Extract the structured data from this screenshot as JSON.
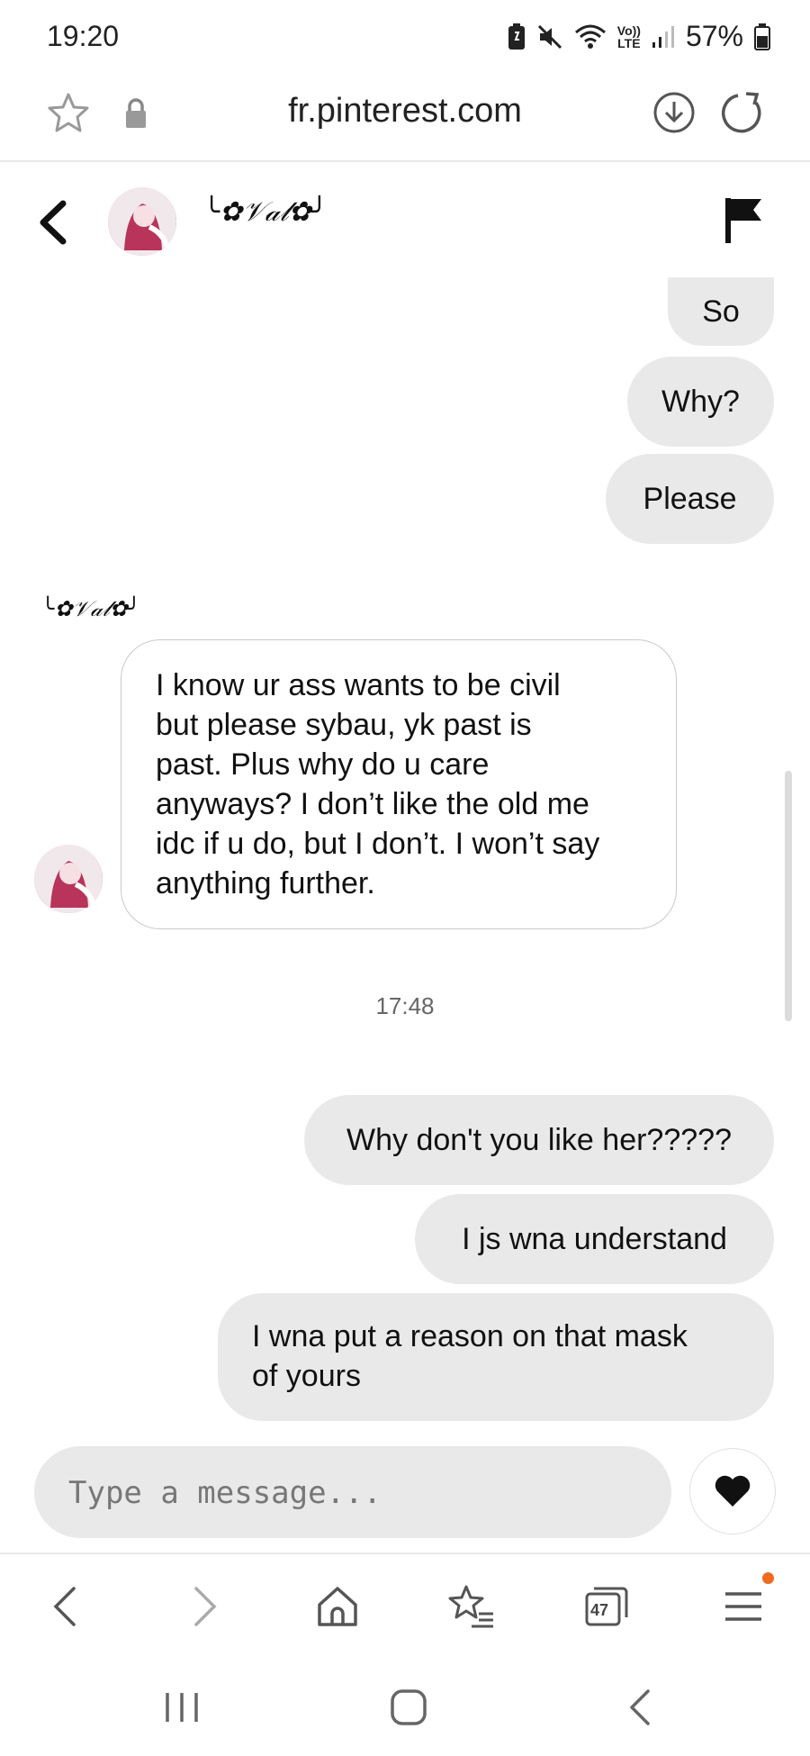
{
  "status_bar": {
    "time": "19:20",
    "battery": "57%",
    "network_top": "Vo))",
    "network_bottom": "LTE"
  },
  "browser": {
    "url": "fr.pinterest.com",
    "tab_count": "47"
  },
  "chat": {
    "contact_name": "╰✿𝒱𝒶𝓁✿╯",
    "messages_top": [
      {
        "text": "So"
      },
      {
        "text": "Why?"
      },
      {
        "text": "Please"
      }
    ],
    "incoming_sender": "╰✿𝒱𝒶𝓁✿╯",
    "incoming_lines": [
      "I know ur ass wants to be civil",
      "but please sybau, yk past is",
      "past. Plus why do u care",
      "anyways? I don’t like the old me",
      "idc if u do, but I don’t. I won’t say",
      "anything further."
    ],
    "timestamp": "17:48",
    "messages_bottom": [
      {
        "text": "Why don't you like her?????"
      },
      {
        "text": "I js wna understand"
      },
      {
        "line1": "I wna put a reason on that mask",
        "line2": "of yours"
      }
    ]
  },
  "composer": {
    "placeholder": "Type a message..."
  },
  "icons": {
    "back": "chevron-left-icon",
    "report": "flag-icon",
    "like": "heart-icon",
    "bookmark": "star-icon",
    "secure": "lock-icon",
    "download": "download-icon",
    "reload": "reload-icon",
    "nav_back": "chevron-left-icon",
    "nav_forward": "chevron-right-icon",
    "home": "home-icon",
    "bookmarks": "bookmarks-icon",
    "tabs": "tabs-icon",
    "menu": "menu-icon"
  },
  "colors": {
    "outgoing_bubble": "#e9e9e9",
    "incoming_border": "#c9c9c9",
    "badge": "#f06a1f"
  }
}
